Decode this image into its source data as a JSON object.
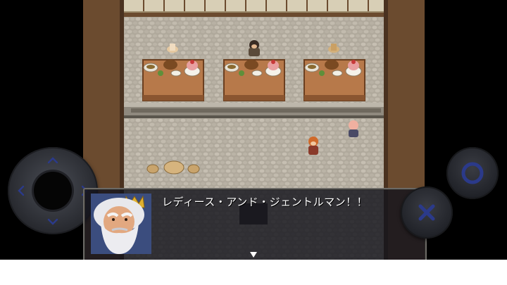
{
  "dialog": {
    "text": "レディース・アンド・ジェントルマン！！",
    "speaker_portrait": "old-bearded-king-portrait-icon",
    "advance_indicator": "down-triangle-icon"
  },
  "controls": {
    "dpad": {
      "up_icon": "chevron-up-icon",
      "down_icon": "chevron-down-icon",
      "left_icon": "chevron-left-icon",
      "right_icon": "chevron-right-icon"
    },
    "confirm_button_icon": "circle-icon",
    "cancel_button_icon": "cross-icon"
  },
  "colors": {
    "control_accent": "#2b3a8a",
    "message_text": "#ffffff",
    "floor_stone": "#b3aca0",
    "table_wood": "#b7794a",
    "wall_wood": "#6b4b2f"
  }
}
